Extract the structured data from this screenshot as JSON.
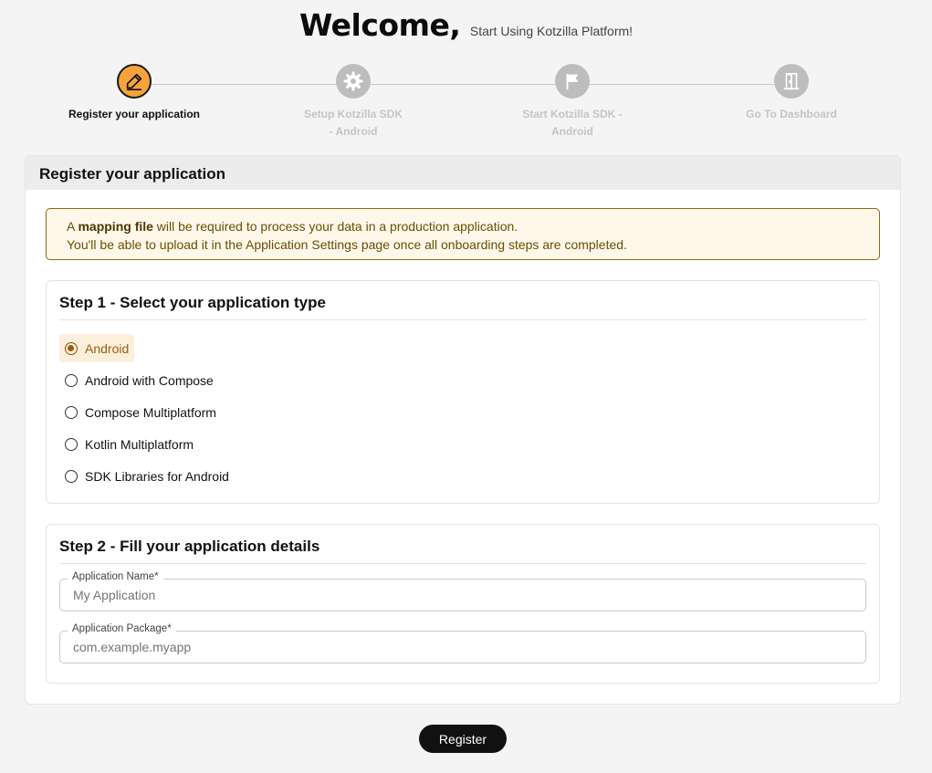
{
  "header": {
    "title": "Welcome,",
    "subtitle": "Start Using Kotzilla Platform!"
  },
  "stepper": {
    "steps": [
      {
        "label": "Register your application",
        "icon": "pencil-icon",
        "active": true
      },
      {
        "label": "Setup Kotzilla SDK - Android",
        "icon": "gear-icon",
        "active": false
      },
      {
        "label": "Start Kotzilla SDK - Android",
        "icon": "flag-icon",
        "active": false
      },
      {
        "label": "Go To Dashboard",
        "icon": "door-icon",
        "active": false
      }
    ]
  },
  "card": {
    "title": "Register your application"
  },
  "notice": {
    "prefix": "A ",
    "bold": "mapping file",
    "suffix": " will be required to process your data in a production application.",
    "line2": "You'll be able to upload it in the Application Settings page once all onboarding steps are completed."
  },
  "step1": {
    "title": "Step 1 - Select your application type",
    "options": [
      "Android",
      "Android with Compose",
      "Compose Multiplatform",
      "Kotlin Multiplatform",
      "SDK Libraries for Android"
    ],
    "selected": "Android"
  },
  "step2": {
    "title": "Step 2 - Fill your application details",
    "name_label": "Application Name*",
    "name_placeholder": "My Application",
    "package_label": "Application Package*",
    "package_placeholder": "com.example.myapp"
  },
  "actions": {
    "register_label": "Register"
  },
  "colors": {
    "accent": "#f6a33b",
    "inactive_step": "#bdbdbd",
    "notice_bg": "#fff8ea",
    "notice_border": "#8a6a12",
    "button_bg": "#111111"
  }
}
